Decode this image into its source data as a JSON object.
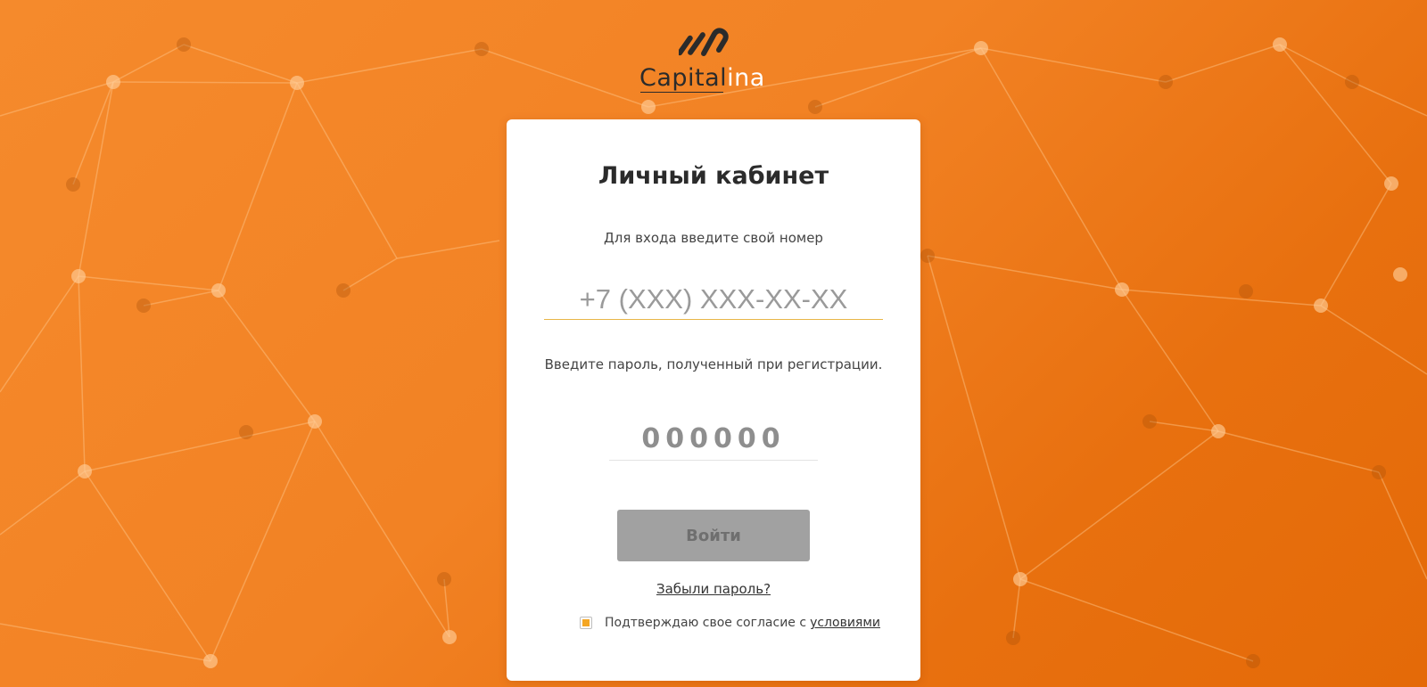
{
  "brand": {
    "name_dark": "Capital",
    "name_light": "ina",
    "icon": "capitalina-logo-mark"
  },
  "login": {
    "title": "Личный кабинет",
    "phone_hint": "Для входа введите свой номер",
    "phone_placeholder": "+7 (XXX) XXX-XX-XX",
    "password_hint": "Введите пароль, полученный при регистрации.",
    "code_placeholder": "000000",
    "submit_label": "Войти",
    "forgot_label": "Забыли пароль?",
    "consent_text": "Подтверждаю свое согласие с",
    "consent_link": "условиями",
    "consent_checked": true
  },
  "colors": {
    "background": "#f28224",
    "accent": "#f4a623",
    "button_disabled": "#a1a1a1",
    "card": "#ffffff"
  }
}
